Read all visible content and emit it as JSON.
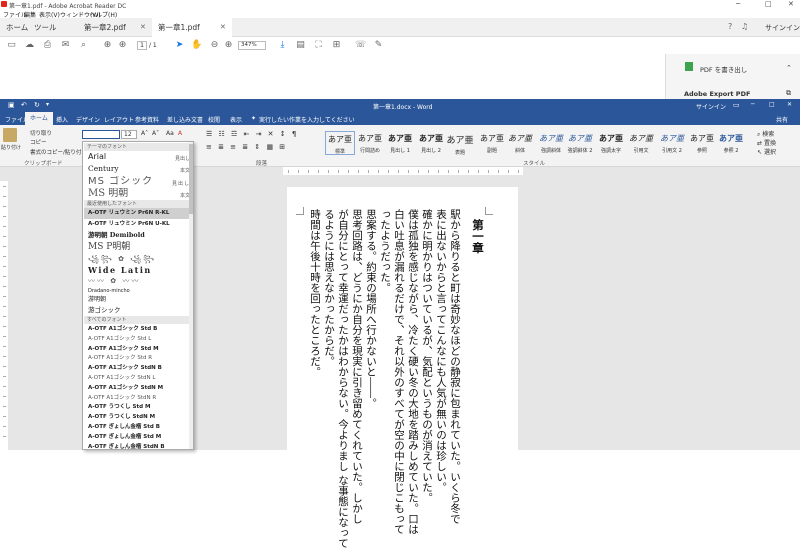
{
  "acrobat": {
    "title": "第一章1.pdf - Adobe Acrobat Reader DC",
    "menu": [
      "ファイル",
      "編集",
      "表示(V)",
      "ウィンドウ(W)",
      "ヘルプ(H)"
    ],
    "tabs": [
      "ホーム",
      "ツール",
      "第一章2.pdf",
      "第一章1.pdf"
    ],
    "signin": "サインイン",
    "page_current": "1",
    "page_total": "/ 1",
    "zoom": "347%",
    "pane_btn": "PDF を書き出し",
    "pane_title": "Adobe Export PDF"
  },
  "word": {
    "title": "第一章1.docx - Word",
    "signin": "サインイン",
    "share": "共有",
    "tabs": [
      "ファイル",
      "ホーム",
      "挿入",
      "デザイン",
      "レイアウト",
      "参考資料",
      "差し込み文書",
      "校閲",
      "表示"
    ],
    "tellme": "実行したい作業を入力してください",
    "clipboard": {
      "paste": "貼り付け",
      "cut": "切り取り",
      "copy": "コピー",
      "format": "書式のコピー/貼り付け",
      "label": "クリップボード"
    },
    "font_size": "12",
    "paragraph_label": "段落",
    "styles_label": "スタイル",
    "edit": {
      "find": "検索",
      "replace": "置換",
      "select": "選択"
    },
    "styles": [
      {
        "s": "あア亜",
        "n": "標準"
      },
      {
        "s": "あア亜",
        "n": "行間詰め"
      },
      {
        "s": "あア亜",
        "n": "見出し 1"
      },
      {
        "s": "あア亜",
        "n": "見出し 2"
      },
      {
        "s": "あア亜",
        "n": "表題"
      },
      {
        "s": "あア亜",
        "n": "副題"
      },
      {
        "s": "あア亜",
        "n": "斜体"
      },
      {
        "s": "あア亜",
        "n": "強調斜体"
      },
      {
        "s": "あア亜",
        "n": "強調斜体 2"
      },
      {
        "s": "あア亜",
        "n": "強調太字"
      },
      {
        "s": "あア亜",
        "n": "引用文"
      },
      {
        "s": "あア亜",
        "n": "引用文 2"
      },
      {
        "s": "あア亜",
        "n": "参照"
      },
      {
        "s": "あア亜",
        "n": "参照 2"
      }
    ]
  },
  "font_dropdown": {
    "theme_header": "テーマのフォント",
    "theme": [
      {
        "name": "Arial",
        "role": "見出し"
      },
      {
        "name": "Century",
        "role": "本文"
      },
      {
        "name": "MS ゴシック",
        "role": "見出し"
      },
      {
        "name": "MS 明朝",
        "role": "本文"
      }
    ],
    "recent_header": "最近使用したフォント",
    "recent": [
      "A-OTF リュウミン Pr6N R-KL",
      "A-OTF リュウミン Pr6N U-KL",
      "游明朝 Demibold",
      "MS P明朝",
      "꧁꧂ ✿ ꧁꧂",
      "Wide Latin",
      "〰〰 ✿ 〰〰",
      "Dradano-mincho",
      "游明朝",
      "游ゴシック"
    ],
    "all_header": "すべてのフォント",
    "all": [
      "A-OTF A1ゴシック Std B",
      "A-OTF A1ゴシック Std L",
      "A-OTF A1ゴシック Std M",
      "A-OTF A1ゴシック Std R",
      "A-OTF A1ゴシック StdN B",
      "A-OTF A1ゴシック StdN L",
      "A-OTF A1ゴシック StdN M",
      "A-OTF A1ゴシック StdN R",
      "A-OTF うつくし Std M",
      "A-OTF うつくし StdN M",
      "A-OTF ぎょしん金楷 Std B",
      "A-OTF ぎょしん金楷 Std M",
      "A-OTF ぎょしん金楷 StdN B"
    ]
  },
  "document": {
    "lines": [
      "第一章",
      "駅から降りると町は奇妙なほどの静寂に包まれていた。いくら冬で",
      "表に出ないからと言ってこんなにも人気が無いのは珍しい。",
      "確かに明かりはついているが、気配というものが消えていた。",
      "僕は孤独を感じながら、冷たく硬い冬の大地を踏みしめていた。口は",
      "白い吐息が漏れるだけで、それ以外のすべてが空の中に閉じこもって",
      "ったようだった。",
      "思案する。約束の場所へ行かないと――。",
      "思考回路は、どうにか自分を現実に引き留めてくれていた。しかし",
      "が自分にとって幸運だったかはわからない。今よりまし な事態になって",
      "るようには思えなかったからだ。",
      "時間は午後十時を回ったところだ。"
    ]
  },
  "colors": {
    "word_blue": "#2b579a",
    "acrobat_red": "#e2231a"
  }
}
